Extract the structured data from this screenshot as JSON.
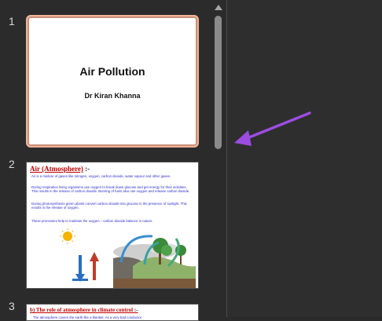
{
  "slides": [
    {
      "number": "1",
      "title": "Air Pollution",
      "subtitle": "Dr Kiran Khanna"
    },
    {
      "number": "2",
      "heading_red": "Air (Atmosphere)",
      "heading_rest": " :-",
      "paragraphs": [
        "Air is a mixture of gases like nitrogen, oxygen, carbon dioxide, water vapour and other gases.",
        "During respiration living organisms use oxygen to break down glucose and get energy for their activities. This results in the release of carbon dioxide. Burning of fuels also use oxygen and release carbon dioxide.",
        "During photosynthesis green plants convert carbon dioxide into glucose in the presence of sunlight. This results in the release of oxygen.",
        "These processes help to maintain the oxygen – carbon dioxide balance in nature."
      ]
    },
    {
      "number": "3",
      "heading": "b) The role of atmosphere in climate control",
      "heading_rest": " :-",
      "line": "The atmosphere covers the earth like a blanket. As a very bad conductor"
    }
  ],
  "icons": {
    "scroll_up": "scroll-up-arrow-icon",
    "annotation": "purple-arrow-icon"
  },
  "colors": {
    "selected_border": "#f0b49a",
    "annotation_arrow": "#9b4de0"
  }
}
